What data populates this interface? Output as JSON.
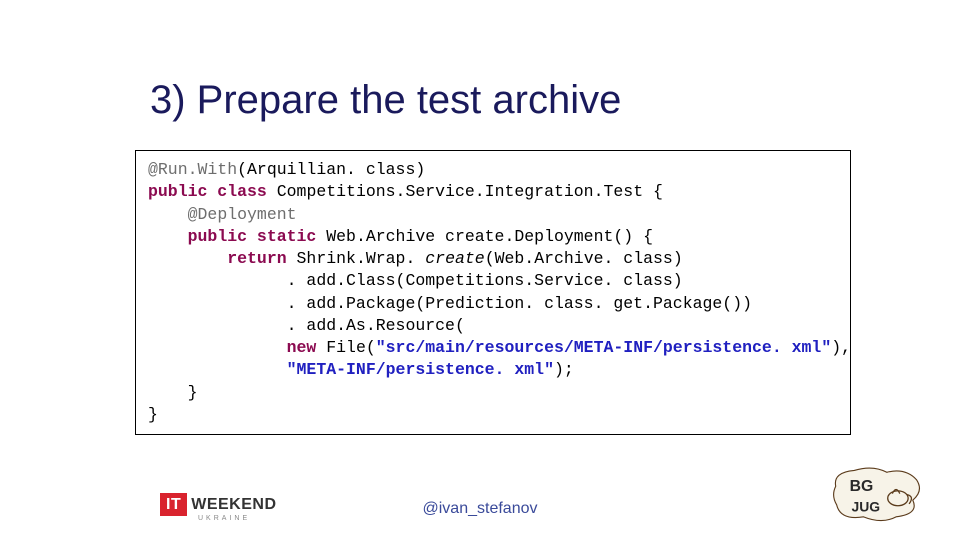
{
  "title": "3) Prepare the test archive",
  "code": {
    "l1_at": "@Run.With",
    "l1_rest": "(Arquillian. class)",
    "l2_kw": "public class ",
    "l2_rest": "Competitions.Service.Integration.Test {",
    "l3_at": "@Deployment",
    "l4_kw": "public static ",
    "l4_rest": "Web.Archive create.Deployment() {",
    "l5_kw": "return ",
    "l5_a": "Shrink.Wrap. ",
    "l5_it": "create",
    "l5_b": "(Web.Archive. class)",
    "l6": ". add.Class(Competitions.Service. class)",
    "l7": ". add.Package(Prediction. class. get.Package())",
    "l8": ". add.As.Resource(",
    "l9_kw": "new ",
    "l9_a": "File(",
    "l9_str": "\"src/main/resources/META-INF/persistence. xml\"",
    "l9_b": "),",
    "l10_str": "\"META-INF/persistence. xml\"",
    "l10_b": ");",
    "l11": "}",
    "l12": "}"
  },
  "footer": {
    "handle": "@ivan_stefanov",
    "logo_it": "IT",
    "logo_weekend": "WEEKEND",
    "logo_ukraine": "UKRAINE",
    "logo_bgjug_top": "BG",
    "logo_bgjug_bot": "JUG"
  }
}
